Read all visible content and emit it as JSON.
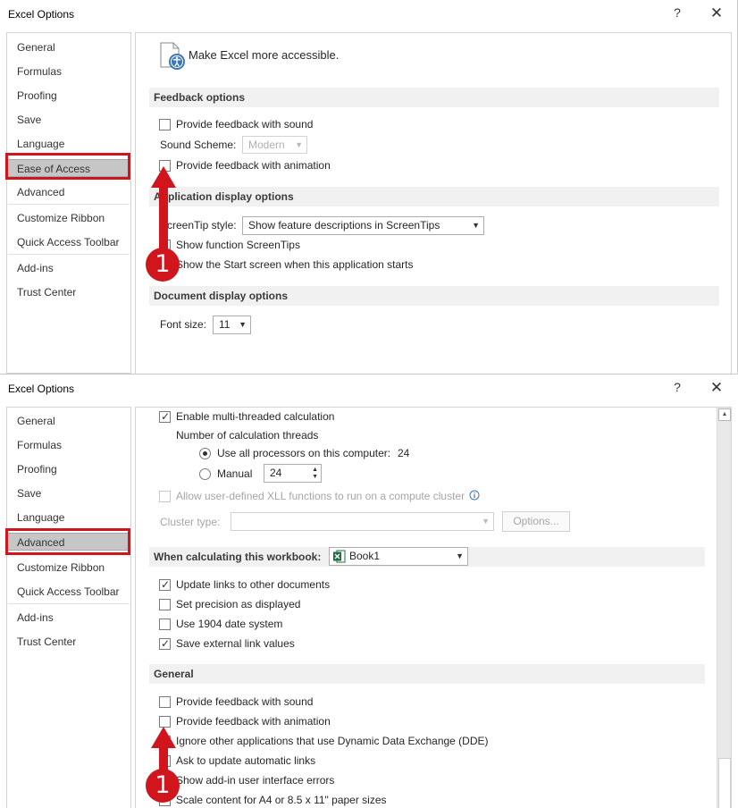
{
  "dialog1": {
    "title": "Excel Options",
    "help": "?",
    "close": "✕",
    "nav": [
      {
        "label": "General"
      },
      {
        "label": "Formulas"
      },
      {
        "label": "Proofing"
      },
      {
        "label": "Save"
      },
      {
        "label": "Language"
      },
      {
        "label": "Ease of Access"
      },
      {
        "label": "Advanced"
      },
      {
        "label": "Customize Ribbon"
      },
      {
        "label": "Quick Access Toolbar"
      },
      {
        "label": "Add-ins"
      },
      {
        "label": "Trust Center"
      }
    ],
    "selected": "Ease of Access",
    "heading": "Make Excel more accessible.",
    "feedback_section": "Feedback options",
    "feedback_sound": "Provide feedback with sound",
    "sound_scheme_label": "Sound Scheme:",
    "sound_scheme_value": "Modern",
    "feedback_animation": "Provide feedback with animation",
    "app_display_section": "Application display options",
    "screentip_label": "ScreenTip style:",
    "screentip_value": "Show feature descriptions in ScreenTips",
    "show_function_screentips": "Show function ScreenTips",
    "show_start_screen": "Show the Start screen when this application starts",
    "doc_display_section": "Document display options",
    "font_size_label": "Font size:",
    "font_size_value": "11",
    "badge": "1"
  },
  "dialog2": {
    "title": "Excel Options",
    "help": "?",
    "close": "✕",
    "selected": "Advanced",
    "multithreaded": "Enable multi-threaded calculation",
    "num_threads": "Number of calculation threads",
    "use_all_processors": "Use all processors on this computer:",
    "processor_count": "24",
    "manual": "Manual",
    "manual_value": "24",
    "allow_xll": "Allow user-defined XLL functions to run on a compute cluster",
    "cluster_type": "Cluster type:",
    "options_button": "Options...",
    "when_calculating": "When calculating this workbook:",
    "workbook": "Book1",
    "update_links": "Update links to other documents",
    "set_precision": "Set precision as displayed",
    "use_1904": "Use 1904 date system",
    "save_external": "Save external link values",
    "general_section": "General",
    "feedback_sound": "Provide feedback with sound",
    "feedback_animation": "Provide feedback with animation",
    "ignore_dde": "Ignore other applications that use Dynamic Data Exchange (DDE)",
    "ask_update": "Ask to update automatic links",
    "show_addin_errors": "Show add-in user interface errors",
    "scale_content": "Scale content for A4 or 8.5 x 11\" paper sizes",
    "badge": "1"
  },
  "colors": {
    "annotation_red": "#d0161c",
    "selected_nav": "#c6c6c6",
    "section_bar": "#f1f1f1"
  },
  "icons": [
    "accessibility-icon",
    "excel-workbook-icon",
    "info-icon",
    "close-icon",
    "help-icon"
  ]
}
